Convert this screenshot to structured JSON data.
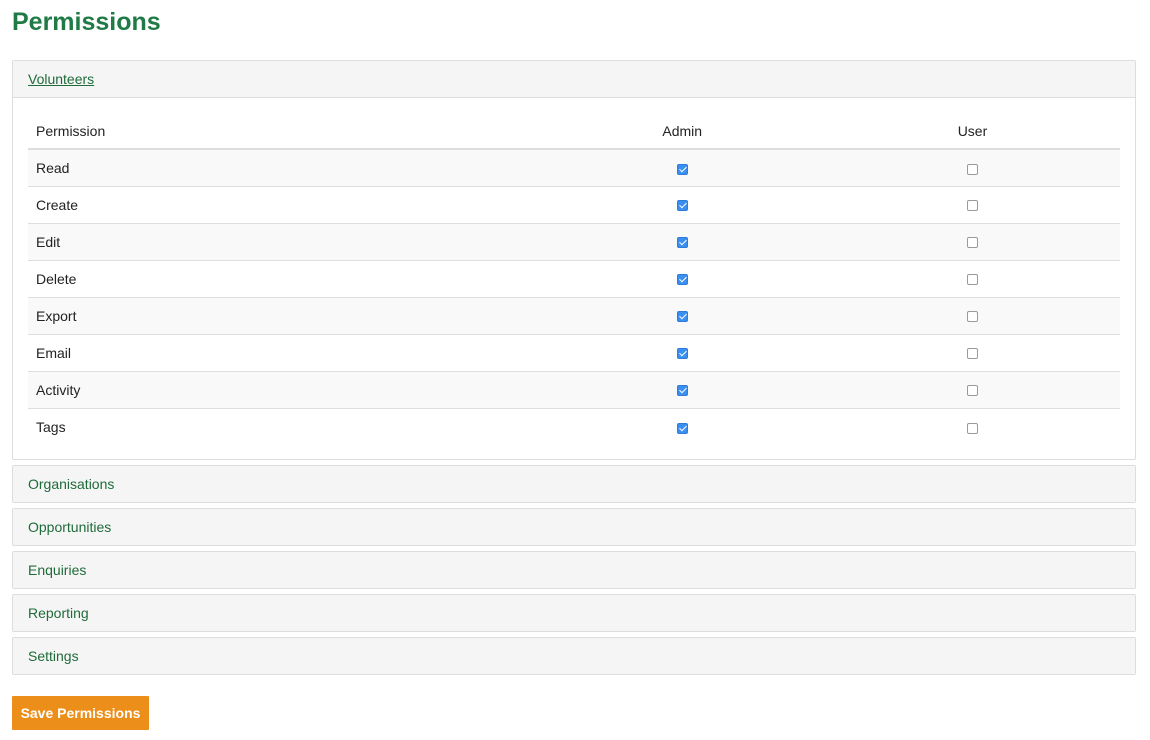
{
  "page": {
    "title": "Permissions"
  },
  "accordion": {
    "sections": [
      {
        "label": "Volunteers",
        "open": true
      },
      {
        "label": "Organisations",
        "open": false
      },
      {
        "label": "Opportunities",
        "open": false
      },
      {
        "label": "Enquiries",
        "open": false
      },
      {
        "label": "Reporting",
        "open": false
      },
      {
        "label": "Settings",
        "open": false
      }
    ]
  },
  "permissions_table": {
    "headers": {
      "permission": "Permission",
      "admin": "Admin",
      "user": "User"
    },
    "rows": [
      {
        "permission": "Read",
        "admin": true,
        "user": false
      },
      {
        "permission": "Create",
        "admin": true,
        "user": false
      },
      {
        "permission": "Edit",
        "admin": true,
        "user": false
      },
      {
        "permission": "Delete",
        "admin": true,
        "user": false
      },
      {
        "permission": "Export",
        "admin": true,
        "user": false
      },
      {
        "permission": "Email",
        "admin": true,
        "user": false
      },
      {
        "permission": "Activity",
        "admin": true,
        "user": false
      },
      {
        "permission": "Tags",
        "admin": true,
        "user": false
      }
    ]
  },
  "actions": {
    "save_label": "Save Permissions"
  },
  "colors": {
    "title_green": "#1f7a45",
    "link_green": "#1f6b3a",
    "button_orange": "#ec8f1a",
    "checkbox_blue": "#3b8ff0"
  }
}
